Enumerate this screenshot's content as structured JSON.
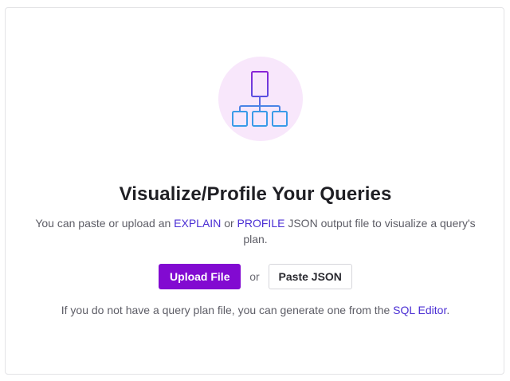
{
  "empty_state": {
    "icon": "query-plan-tree-icon",
    "title": "Visualize/Profile Your Queries",
    "description": {
      "part1": "You can paste or upload an ",
      "explain_link": "EXPLAIN",
      "part2": " or ",
      "profile_link": "PROFILE",
      "part3": " JSON output file to visualize a query's plan."
    },
    "upload_button": "Upload File",
    "or_label": "or",
    "paste_button": "Paste JSON",
    "hint": {
      "text": "If you do not have a query plan file, you can generate one from the ",
      "sql_editor_link": "SQL Editor",
      "suffix": "."
    }
  },
  "colors": {
    "primary": "#820ad1",
    "link": "#4b2fd4",
    "icon_top": "#8b24d6",
    "icon_bottom": "#3a9be8",
    "icon_bg": "#f8e7fb"
  }
}
